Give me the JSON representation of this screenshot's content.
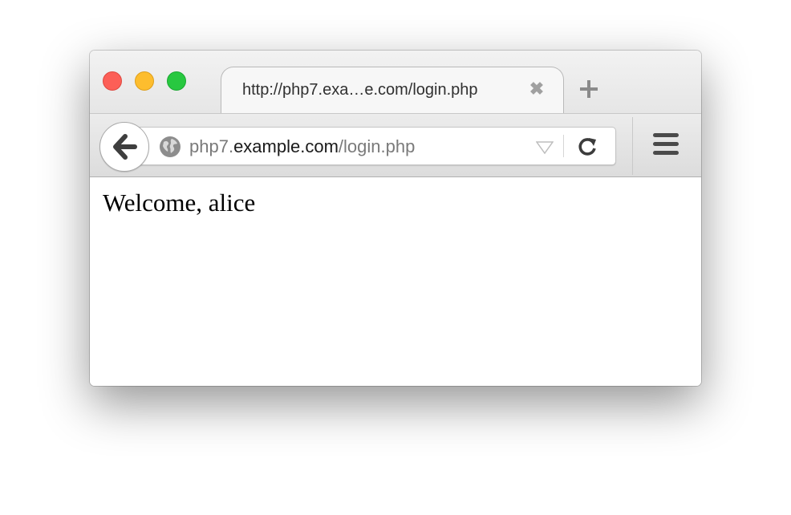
{
  "window": {
    "controls": {
      "close": "close",
      "minimize": "minimize",
      "maximize": "maximize"
    }
  },
  "tab": {
    "title": "http://php7.exa…e.com/login.php",
    "close_glyph": "✖",
    "new_tab_icon": "plus-icon"
  },
  "toolbar": {
    "back_icon": "arrow-left-icon",
    "url": {
      "prefix": "php7.",
      "host": "example.com",
      "path": "/login.php"
    },
    "site_icon": "globe-icon",
    "dropmarker_icon": "triangle-down-icon",
    "reload_icon": "reload-icon",
    "menu_icon": "hamburger-menu-icon"
  },
  "page": {
    "welcome_text": "Welcome, alice"
  },
  "colors": {
    "close": "#fc5f57",
    "minimize": "#fdbd2e",
    "maximize": "#28c840"
  }
}
